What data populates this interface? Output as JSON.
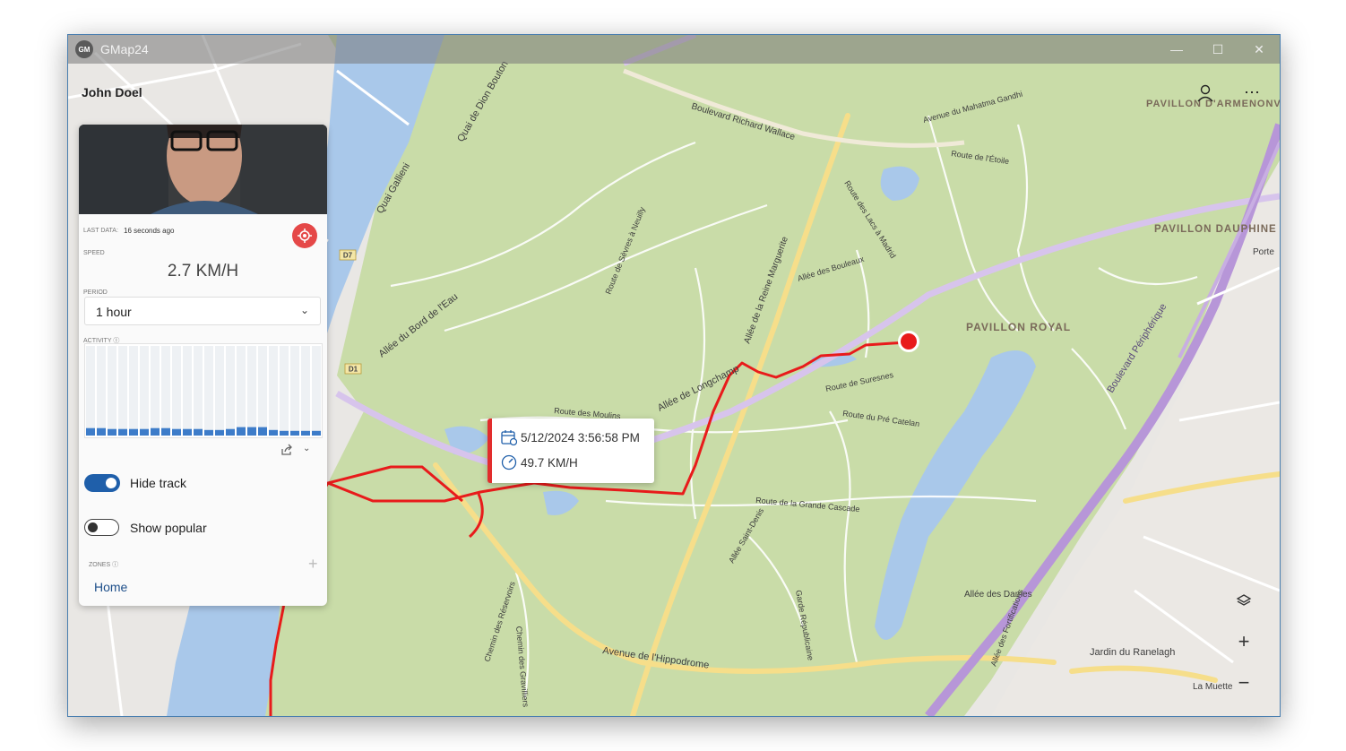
{
  "window": {
    "app_icon": "GM",
    "title": "GMap24",
    "controls": {
      "minimize": "—",
      "maximize": "☐",
      "close": "✕"
    }
  },
  "user": {
    "name": "John Doel"
  },
  "panel": {
    "last_data_label": "LAST DATA:",
    "last_data_value": "16 seconds ago",
    "speed_label": "SPEED",
    "speed_value": "2.7 KM/H",
    "period_label": "PERIOD",
    "period_value": "1 hour",
    "activity_label": "ACTIVITY",
    "activity_levels": [
      0.08,
      0.08,
      0.07,
      0.07,
      0.07,
      0.07,
      0.08,
      0.08,
      0.07,
      0.07,
      0.07,
      0.06,
      0.06,
      0.07,
      0.09,
      0.09,
      0.09,
      0.06,
      0.05,
      0.05,
      0.05,
      0.05
    ],
    "hide_track_label": "Hide track",
    "hide_track_on": true,
    "show_popular_label": "Show popular",
    "show_popular_on": false,
    "zones_label": "ZONES",
    "zones": [
      "Home"
    ]
  },
  "tooltip": {
    "datetime": "5/12/2024 3:56:58 PM",
    "speed": "49.7 KM/H"
  },
  "map": {
    "labels": [
      "Boulevard Richard Wallace",
      "Allée de Longchamp",
      "Allée du Bord de l'Eau",
      "Quai Gallieni",
      "Quai de Dion Bouton",
      "Allée de la Reine Marguerite",
      "Allée des Bouleaux",
      "Route de Suresnes",
      "Route du Pré Catelan",
      "Route des Moulins",
      "Route de la Grande Cascade",
      "Allée Saint-Denis",
      "Avenue de l'Hippodrome",
      "PAVILLON ROYAL",
      "PAVILLON DAUPHINE",
      "PAVILLON D'ARMENONVILLE",
      "Allée des Dames",
      "Allée des Fortifications",
      "Jardin du Ranelagh",
      "La Muette",
      "Boulevard Périphérique",
      "Route des Lacs à Madrid",
      "Route de l'Étoile",
      "Avenue du Mahatma Gandhi",
      "Route de Sèvres à Neuilly",
      "Chemin des Réservoirs",
      "Chemin des Gravilliers",
      "Garde Républicaine",
      "Porte",
      "D7",
      "D1"
    ],
    "icons": {
      "layers": "layers-icon",
      "zoom_in": "+",
      "zoom_out": "−"
    },
    "colors": {
      "park": "#c9dca8",
      "water": "#a9c8ea",
      "track": "#e81b1b",
      "periph": "#b796d8",
      "major_road": "#f6de8a"
    }
  }
}
